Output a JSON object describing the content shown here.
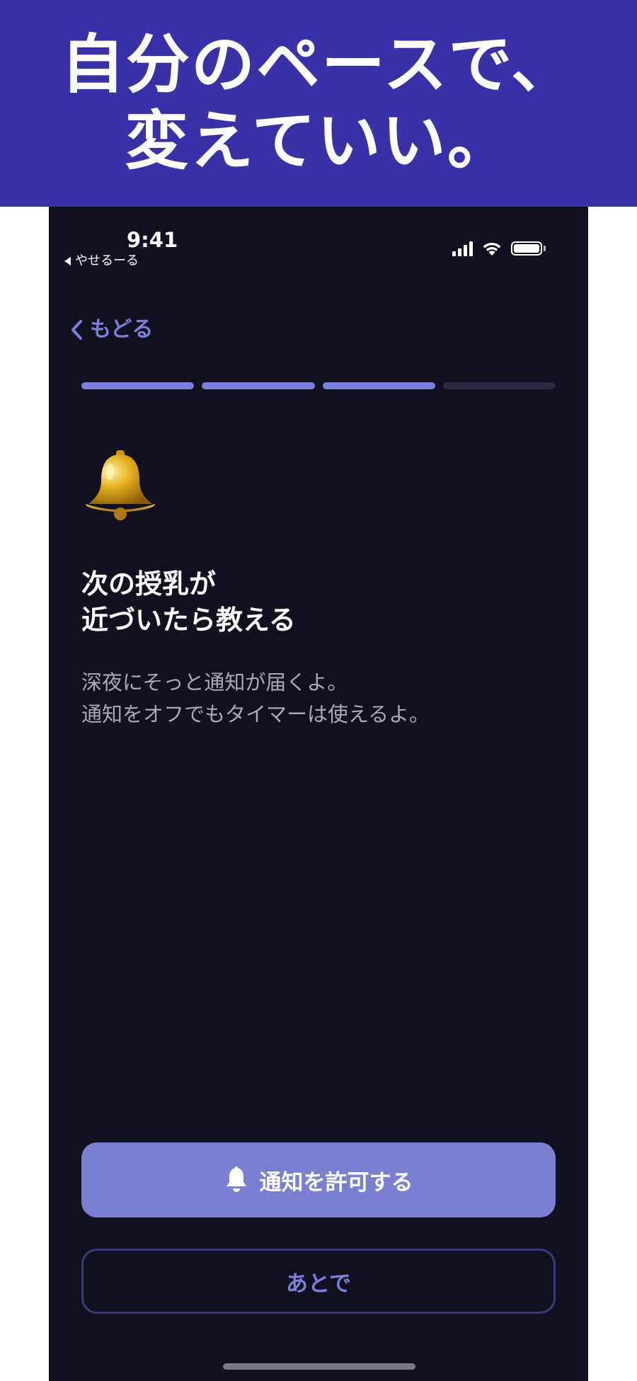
{
  "banner": {
    "line1": "自分のペースで、",
    "line2": "変えていい。",
    "background": "#3a30a8"
  },
  "status_bar": {
    "time": "9:41",
    "back_app": "やせるーる",
    "icons": [
      "signal-icon",
      "wifi-icon",
      "battery-icon"
    ]
  },
  "nav": {
    "back_label": "もどる"
  },
  "progress": {
    "total_steps": 4,
    "completed_steps": 3,
    "accent": "#7b7fd6"
  },
  "content": {
    "icon": "bell-icon",
    "headline_line1": "次の授乳が",
    "headline_line2": "近づいたら教える",
    "body_line1": "深夜にそっと通知が届くよ。",
    "body_line2": "通知をオフでもタイマーは使えるよ。"
  },
  "actions": {
    "primary_label": "通知を許可する",
    "primary_icon": "bell-icon",
    "secondary_label": "あとで"
  },
  "colors": {
    "screen_bg": "#12111f",
    "button_bg": "#7b7fd2",
    "secondary_border": "#3e3a78"
  }
}
